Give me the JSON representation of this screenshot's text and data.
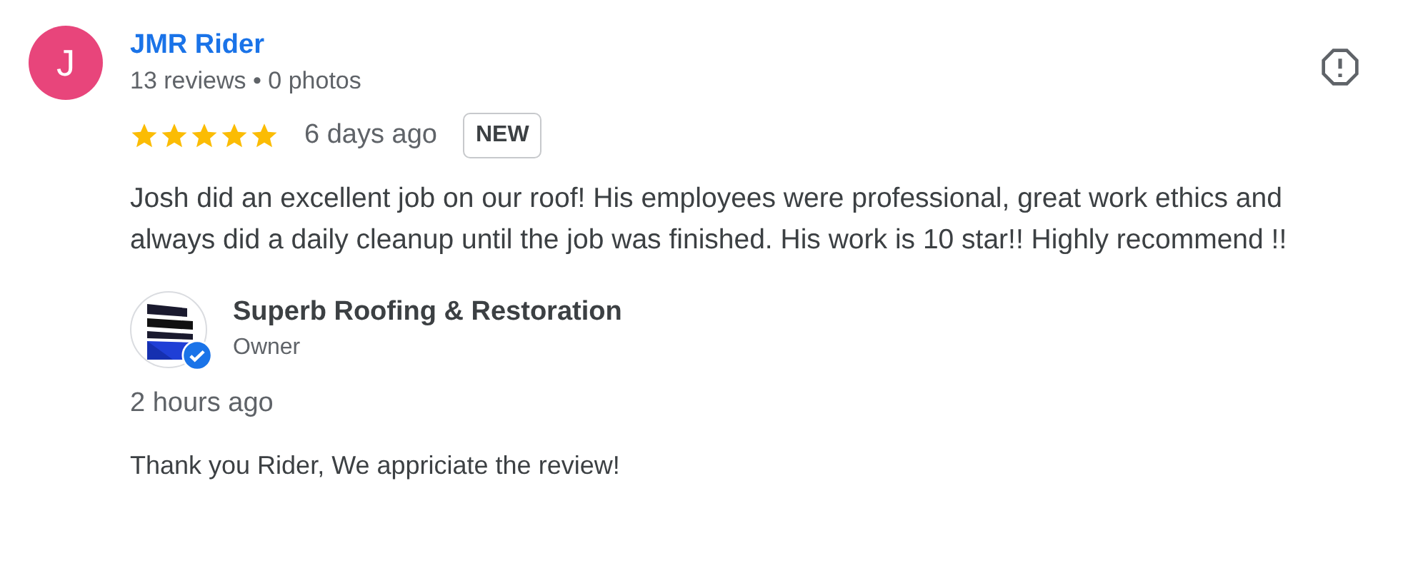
{
  "reviewer": {
    "initial": "J",
    "name": "JMR Rider",
    "meta": "13 reviews • 0 photos"
  },
  "review": {
    "stars": 5,
    "time": "6 days ago",
    "badge": "NEW",
    "text": "Josh did an excellent job on our roof! His employees were professional, great work ethics and always did a daily cleanup until the job was finished. His work is 10 star!! Highly recommend !!"
  },
  "response": {
    "name": "Superb Roofing & Restoration",
    "role": "Owner",
    "verified": true,
    "time": "2 hours ago",
    "text": "Thank you Rider, We appriciate the review!"
  }
}
